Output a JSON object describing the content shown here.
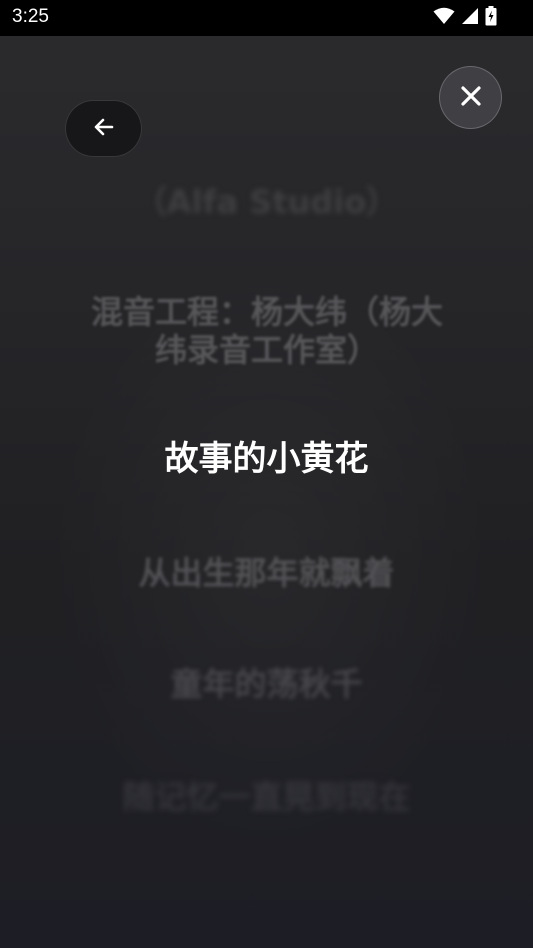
{
  "status_bar": {
    "time": "3:25",
    "icons": [
      "wifi-icon",
      "cellular-signal-icon",
      "battery-charging-icon"
    ]
  },
  "controls": {
    "back_icon": "arrow-left-icon",
    "close_icon": "close-icon"
  },
  "lyrics": {
    "lines": [
      "（Alfa Studio）",
      "混音工程：杨大纬（杨大纬录音工作室）",
      "故事的小黄花",
      "从出生那年就飘着",
      "童年的荡秋千",
      "随记忆一直晃到现在"
    ],
    "current_index": 2
  },
  "colors": {
    "background_top": "#2b2b2e",
    "background_bottom": "#1d1e25",
    "current_lyric": "#ffffff",
    "dim_lyric": "#8c8c8c",
    "close_button": "#3f3f44",
    "back_button": "#171719"
  }
}
